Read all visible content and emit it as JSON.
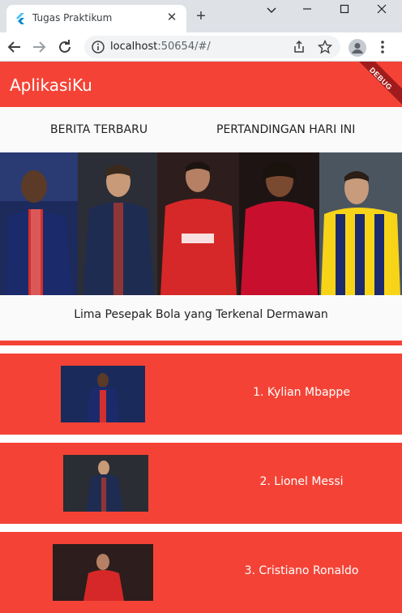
{
  "browser": {
    "tab_title": "Tugas Praktikum",
    "url_host": "localhost",
    "url_rest": ":50654/#/"
  },
  "app": {
    "title": "AplikasiKu",
    "debug_label": "DEBUG",
    "tabs": [
      {
        "label": "BERITA TERBARU"
      },
      {
        "label": "PERTANDINGAN HARI INI"
      }
    ],
    "banner_caption": "Lima Pesepak Bola yang Terkenal Dermawan",
    "players": [
      {
        "label": "1. Kylian Mbappe"
      },
      {
        "label": "2. Lionel Messi"
      },
      {
        "label": "3. Cristiano Ronaldo"
      }
    ]
  },
  "colors": {
    "accent": "#f44336",
    "browser_chrome": "#dee1e6"
  }
}
